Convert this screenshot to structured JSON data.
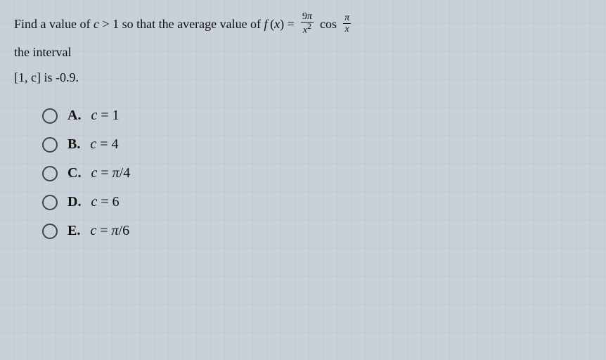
{
  "question": {
    "line1_prefix": "Find a value of ",
    "line1_var": "c",
    "line1_mid": " > 1 so that the average value of ",
    "line1_func": "f",
    "line1_xvar": "(x)",
    "line1_equals": " = ",
    "line1_frac_num": "9π",
    "line1_frac_den": "x²",
    "line1_cos": " cos ",
    "line1_cos_frac_num": "π",
    "line1_cos_frac_den": "x",
    "line2": "the interval",
    "line3": "[1, c] is -0.9."
  },
  "options": [
    {
      "id": "A",
      "label": "A.",
      "text": "c = 1"
    },
    {
      "id": "B",
      "label": "B.",
      "text": "c = 4"
    },
    {
      "id": "C",
      "label": "C.",
      "text": "c = π/4"
    },
    {
      "id": "D",
      "label": "D.",
      "text": "c = 6"
    },
    {
      "id": "E",
      "label": "E.",
      "text": "c = π/6"
    }
  ]
}
